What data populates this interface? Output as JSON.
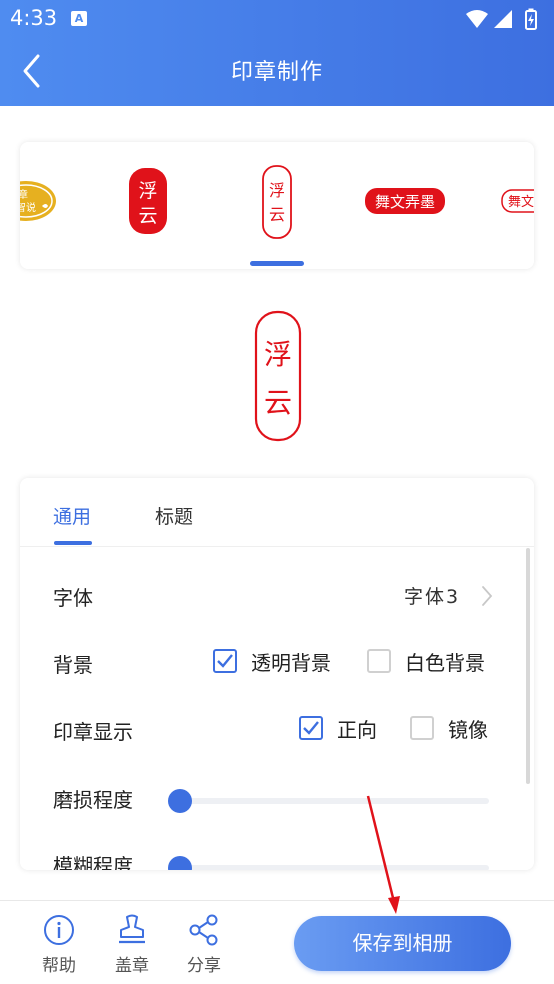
{
  "status_bar": {
    "time": "4:33",
    "notification_icon": "a-icon"
  },
  "app_bar": {
    "title": "印章制作",
    "back_icon": "chevron-left-icon"
  },
  "carousel": {
    "thumbs": [
      {
        "name": "seal-thumb-oval-gold",
        "text": "章 智说"
      },
      {
        "name": "seal-thumb-red-solid",
        "text": "浮云"
      },
      {
        "name": "seal-thumb-red-outline-selected",
        "text": "浮云"
      },
      {
        "name": "seal-thumb-red-wide",
        "text": "舞文弄墨"
      },
      {
        "name": "seal-thumb-outline-wide",
        "text": "舞文"
      }
    ],
    "selected_index": 2
  },
  "preview": {
    "text": "浮云"
  },
  "tabs": {
    "general": "通用",
    "title": "标题",
    "active": "general"
  },
  "settings": {
    "font": {
      "label": "字体",
      "value": "字体3"
    },
    "background": {
      "label": "背景",
      "options": [
        {
          "label": "透明背景",
          "checked": true
        },
        {
          "label": "白色背景",
          "checked": false
        }
      ]
    },
    "display": {
      "label": "印章显示",
      "options": [
        {
          "label": "正向",
          "checked": true
        },
        {
          "label": "镜像",
          "checked": false
        }
      ]
    },
    "wear": {
      "label": "磨损程度",
      "level": 0
    },
    "blur": {
      "label": "模糊程度",
      "level": 0
    }
  },
  "bottom_bar": {
    "help": "帮助",
    "stamp": "盖章",
    "share": "分享",
    "save": "保存到相册"
  },
  "colors": {
    "accent": "#3d6fe0",
    "seal_red": "#e0121a",
    "seal_gold": "#e6b020"
  }
}
